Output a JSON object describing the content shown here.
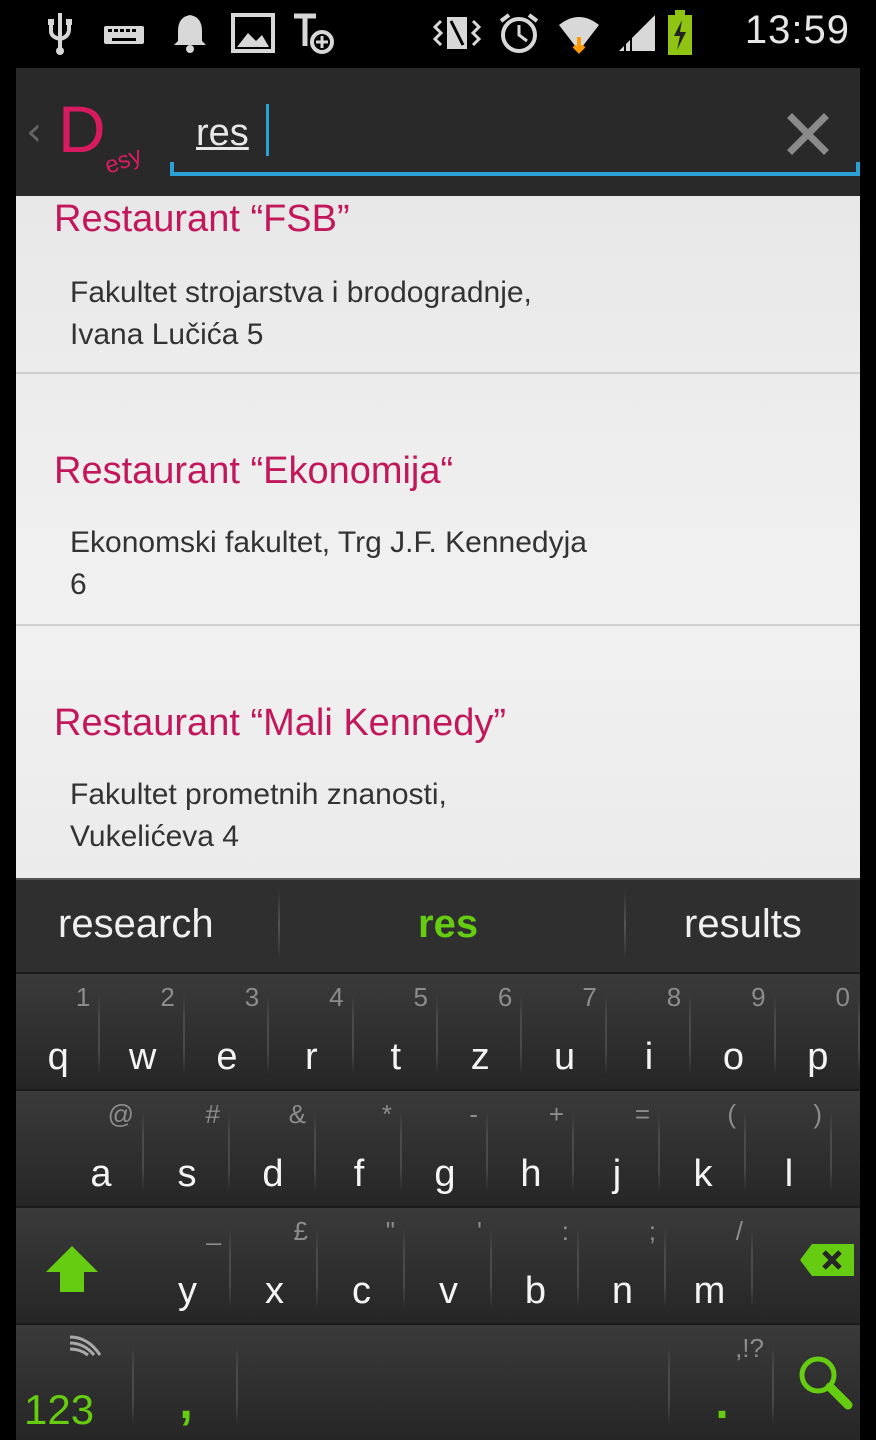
{
  "status_bar": {
    "time": "13:59",
    "icons": [
      "usb-icon",
      "keyboard-icon",
      "notification-bell-icon",
      "image-icon",
      "text-add-icon",
      "vibrate-icon",
      "alarm-icon",
      "wifi-icon",
      "signal-icon",
      "battery-charging-icon"
    ]
  },
  "action_bar": {
    "logo_text": "Desy",
    "search_value": "res",
    "icons": [
      "back-chevron-icon",
      "clear-icon"
    ]
  },
  "results": [
    {
      "title": "Restaurant “FSB”",
      "subtitle_lines": [
        "Fakultet strojarstva i brodogradnje,",
        "Ivana Lučića 5"
      ]
    },
    {
      "title": "Restaurant “Ekonomija“",
      "subtitle_lines": [
        "Ekonomski fakultet, Trg J.F. Kennedyja",
        "6"
      ]
    },
    {
      "title": "Restaurant “Mali Kennedy”",
      "subtitle_lines": [
        "Fakultet prometnih znanosti,",
        "Vukelićeva 4"
      ]
    }
  ],
  "keyboard": {
    "suggestions": [
      "research",
      "res",
      "results"
    ],
    "row1": [
      {
        "key": "q",
        "sec": "1"
      },
      {
        "key": "w",
        "sec": "2"
      },
      {
        "key": "e",
        "sec": "3"
      },
      {
        "key": "r",
        "sec": "4"
      },
      {
        "key": "t",
        "sec": "5"
      },
      {
        "key": "z",
        "sec": "6"
      },
      {
        "key": "u",
        "sec": "7"
      },
      {
        "key": "i",
        "sec": "8"
      },
      {
        "key": "o",
        "sec": "9"
      },
      {
        "key": "p",
        "sec": "0"
      }
    ],
    "row2": [
      {
        "key": "a",
        "sec": "@"
      },
      {
        "key": "s",
        "sec": "#"
      },
      {
        "key": "d",
        "sec": "&"
      },
      {
        "key": "f",
        "sec": "*"
      },
      {
        "key": "g",
        "sec": "-"
      },
      {
        "key": "h",
        "sec": "+"
      },
      {
        "key": "j",
        "sec": "="
      },
      {
        "key": "k",
        "sec": "("
      },
      {
        "key": "l",
        "sec": ")"
      }
    ],
    "row3": [
      {
        "key": "y",
        "sec": "_"
      },
      {
        "key": "x",
        "sec": "£"
      },
      {
        "key": "c",
        "sec": "\""
      },
      {
        "key": "v",
        "sec": "'"
      },
      {
        "key": "b",
        "sec": ":"
      },
      {
        "key": "n",
        "sec": ";"
      },
      {
        "key": "m",
        "sec": "/"
      }
    ],
    "row4": {
      "numbers_label": "123",
      "comma": ",",
      "period": ".",
      "period_sec": ",!?"
    },
    "colors": {
      "accent_green": "#66cc11",
      "magenta": "#c2185b",
      "search_blue": "#2aa0d4"
    }
  }
}
